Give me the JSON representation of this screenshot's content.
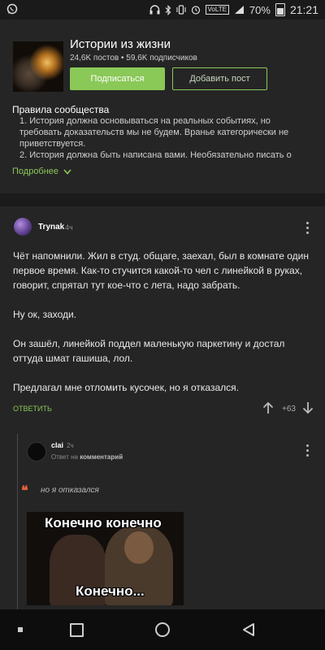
{
  "status_bar": {
    "battery_percent": "70%",
    "time": "21:21",
    "volte": "VoLTE"
  },
  "community": {
    "title": "Истории из жизни",
    "stats": "24,6K постов • 59,6K подписчиков",
    "subscribe_label": "Подписаться",
    "add_post_label": "Добавить пост",
    "rules_title": "Правила сообщества",
    "rules": [
      "1. История должна основываться на реальных событиях, но требовать доказательств мы не будем. Вранье категорически не приветствуется.",
      "2. История должна быть написана вами. Необязательно писать о"
    ],
    "more_label": "Подробнее"
  },
  "post": {
    "author": "Trynak",
    "time": "4ч",
    "paragraphs": [
      "Чёт напомнили. Жил в студ. общаге, заехал, был в комнате один первое время. Как-то стучится какой-то чел с линейкой в руках, говорит, спрятал тут кое-что с лета, надо забрать.",
      "Ну ок, заходи.",
      "Он зашёл, линейкой поддел маленькую паркетину и достал оттуда шмат гашиша, лол.",
      "Предлагал мне отломить кусочек, но я отказался."
    ],
    "reply_label": "ОТВЕТИТЬ",
    "score": "+63"
  },
  "comment": {
    "author": "clai",
    "time": "2ч",
    "meta_prefix": "Ответ на",
    "meta_link": "комментарий",
    "quote": "но я отказался",
    "gif_caption_top": "Конечно конечно",
    "gif_caption_bottom": "Конечно..."
  },
  "colors": {
    "accent": "#8ac858",
    "quote": "#e0603a",
    "background": "#1b1b1b",
    "card": "#252525"
  }
}
